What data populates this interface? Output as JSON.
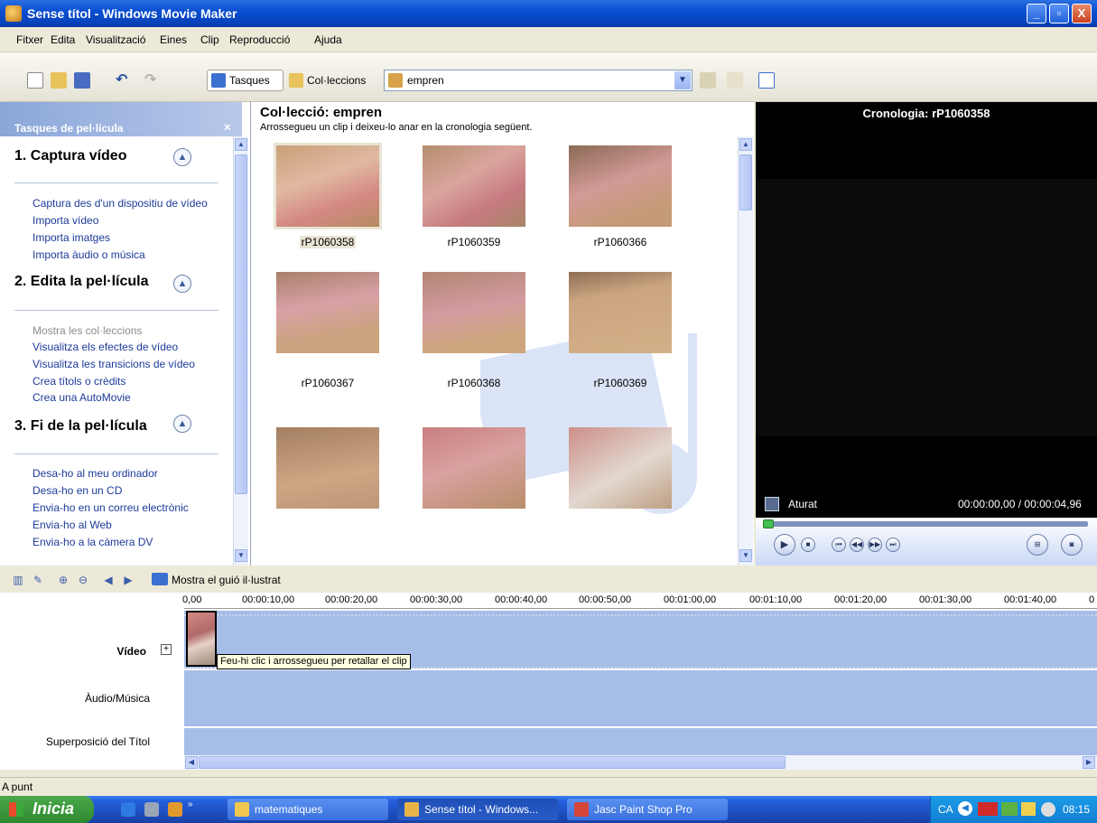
{
  "window": {
    "title": "Sense títol - Windows Movie Maker",
    "minimize_glyph": "_",
    "maximize_glyph": "▫",
    "close_glyph": "X"
  },
  "menu": [
    "Fitxer",
    "Edita",
    "Visualització",
    "Eines",
    "Clip",
    "Reproducció",
    "Ajuda"
  ],
  "toolbar": {
    "tasks_label": "Tasques",
    "collections_label": "Col·leccions",
    "collection_value": "empren"
  },
  "taskpane": {
    "header": "Tasques de pel·lícula",
    "close_glyph": "×",
    "sections": [
      {
        "title": "1. Captura vídeo",
        "items": [
          "Captura des d'un dispositiu de vídeo",
          "Importa vídeo",
          "Importa imatges",
          "Importa àudio o música"
        ]
      },
      {
        "title": "2. Edita la pel·lícula",
        "items": [
          "Mostra les col·leccions",
          "Visualitza els efectes de vídeo",
          "Visualitza les transicions de vídeo",
          "Crea títols o crèdits",
          "Crea una AutoMovie"
        ]
      },
      {
        "title": "3. Fi de la pel·lícula",
        "items": [
          "Desa-ho al meu ordinador",
          "Desa-ho en un CD",
          "Envia-ho en un correu electrònic",
          "Envia-ho al Web",
          "Envia-ho a la càmera DV"
        ]
      }
    ]
  },
  "collection": {
    "title": "Col·lecció: empren",
    "hint": "Arrossegueu un clip i deixeu-lo anar en la cronologia següent.",
    "clips": [
      {
        "name": "rP1060358",
        "selected": true
      },
      {
        "name": "rP1060359",
        "selected": false
      },
      {
        "name": "rP1060366",
        "selected": false
      },
      {
        "name": "rP1060367",
        "selected": false
      },
      {
        "name": "rP1060368",
        "selected": false
      },
      {
        "name": "rP1060369",
        "selected": false
      },
      {
        "name": "",
        "selected": false
      },
      {
        "name": "",
        "selected": false
      },
      {
        "name": "",
        "selected": false
      }
    ]
  },
  "preview": {
    "title": "Cronologia: rP1060358",
    "status": "Aturat",
    "time": "00:00:00,00 / 00:00:04,96"
  },
  "timeline": {
    "storyboard_label": "Mostra el guió il·lustrat",
    "ruler": [
      "0,00",
      "00:00:10,00",
      "00:00:20,00",
      "00:00:30,00",
      "00:00:40,00",
      "00:00:50,00",
      "00:01:00,00",
      "00:01:10,00",
      "00:01:20,00",
      "00:01:30,00",
      "00:01:40,00",
      "0"
    ],
    "tracks": {
      "video": "Vídeo",
      "audio": "Àudio/Música",
      "title_overlay": "Superposició del Títol"
    },
    "tooltip": "Feu-hi clic i arrossegueu per retallar el clip"
  },
  "statusbar": {
    "text": "A punt"
  },
  "taskbar": {
    "start": "Inicia",
    "buttons": [
      "matematiques",
      "Sense títol - Windows...",
      "Jasc Paint Shop Pro"
    ],
    "tray_lang": "CA",
    "clock": "08:15"
  }
}
